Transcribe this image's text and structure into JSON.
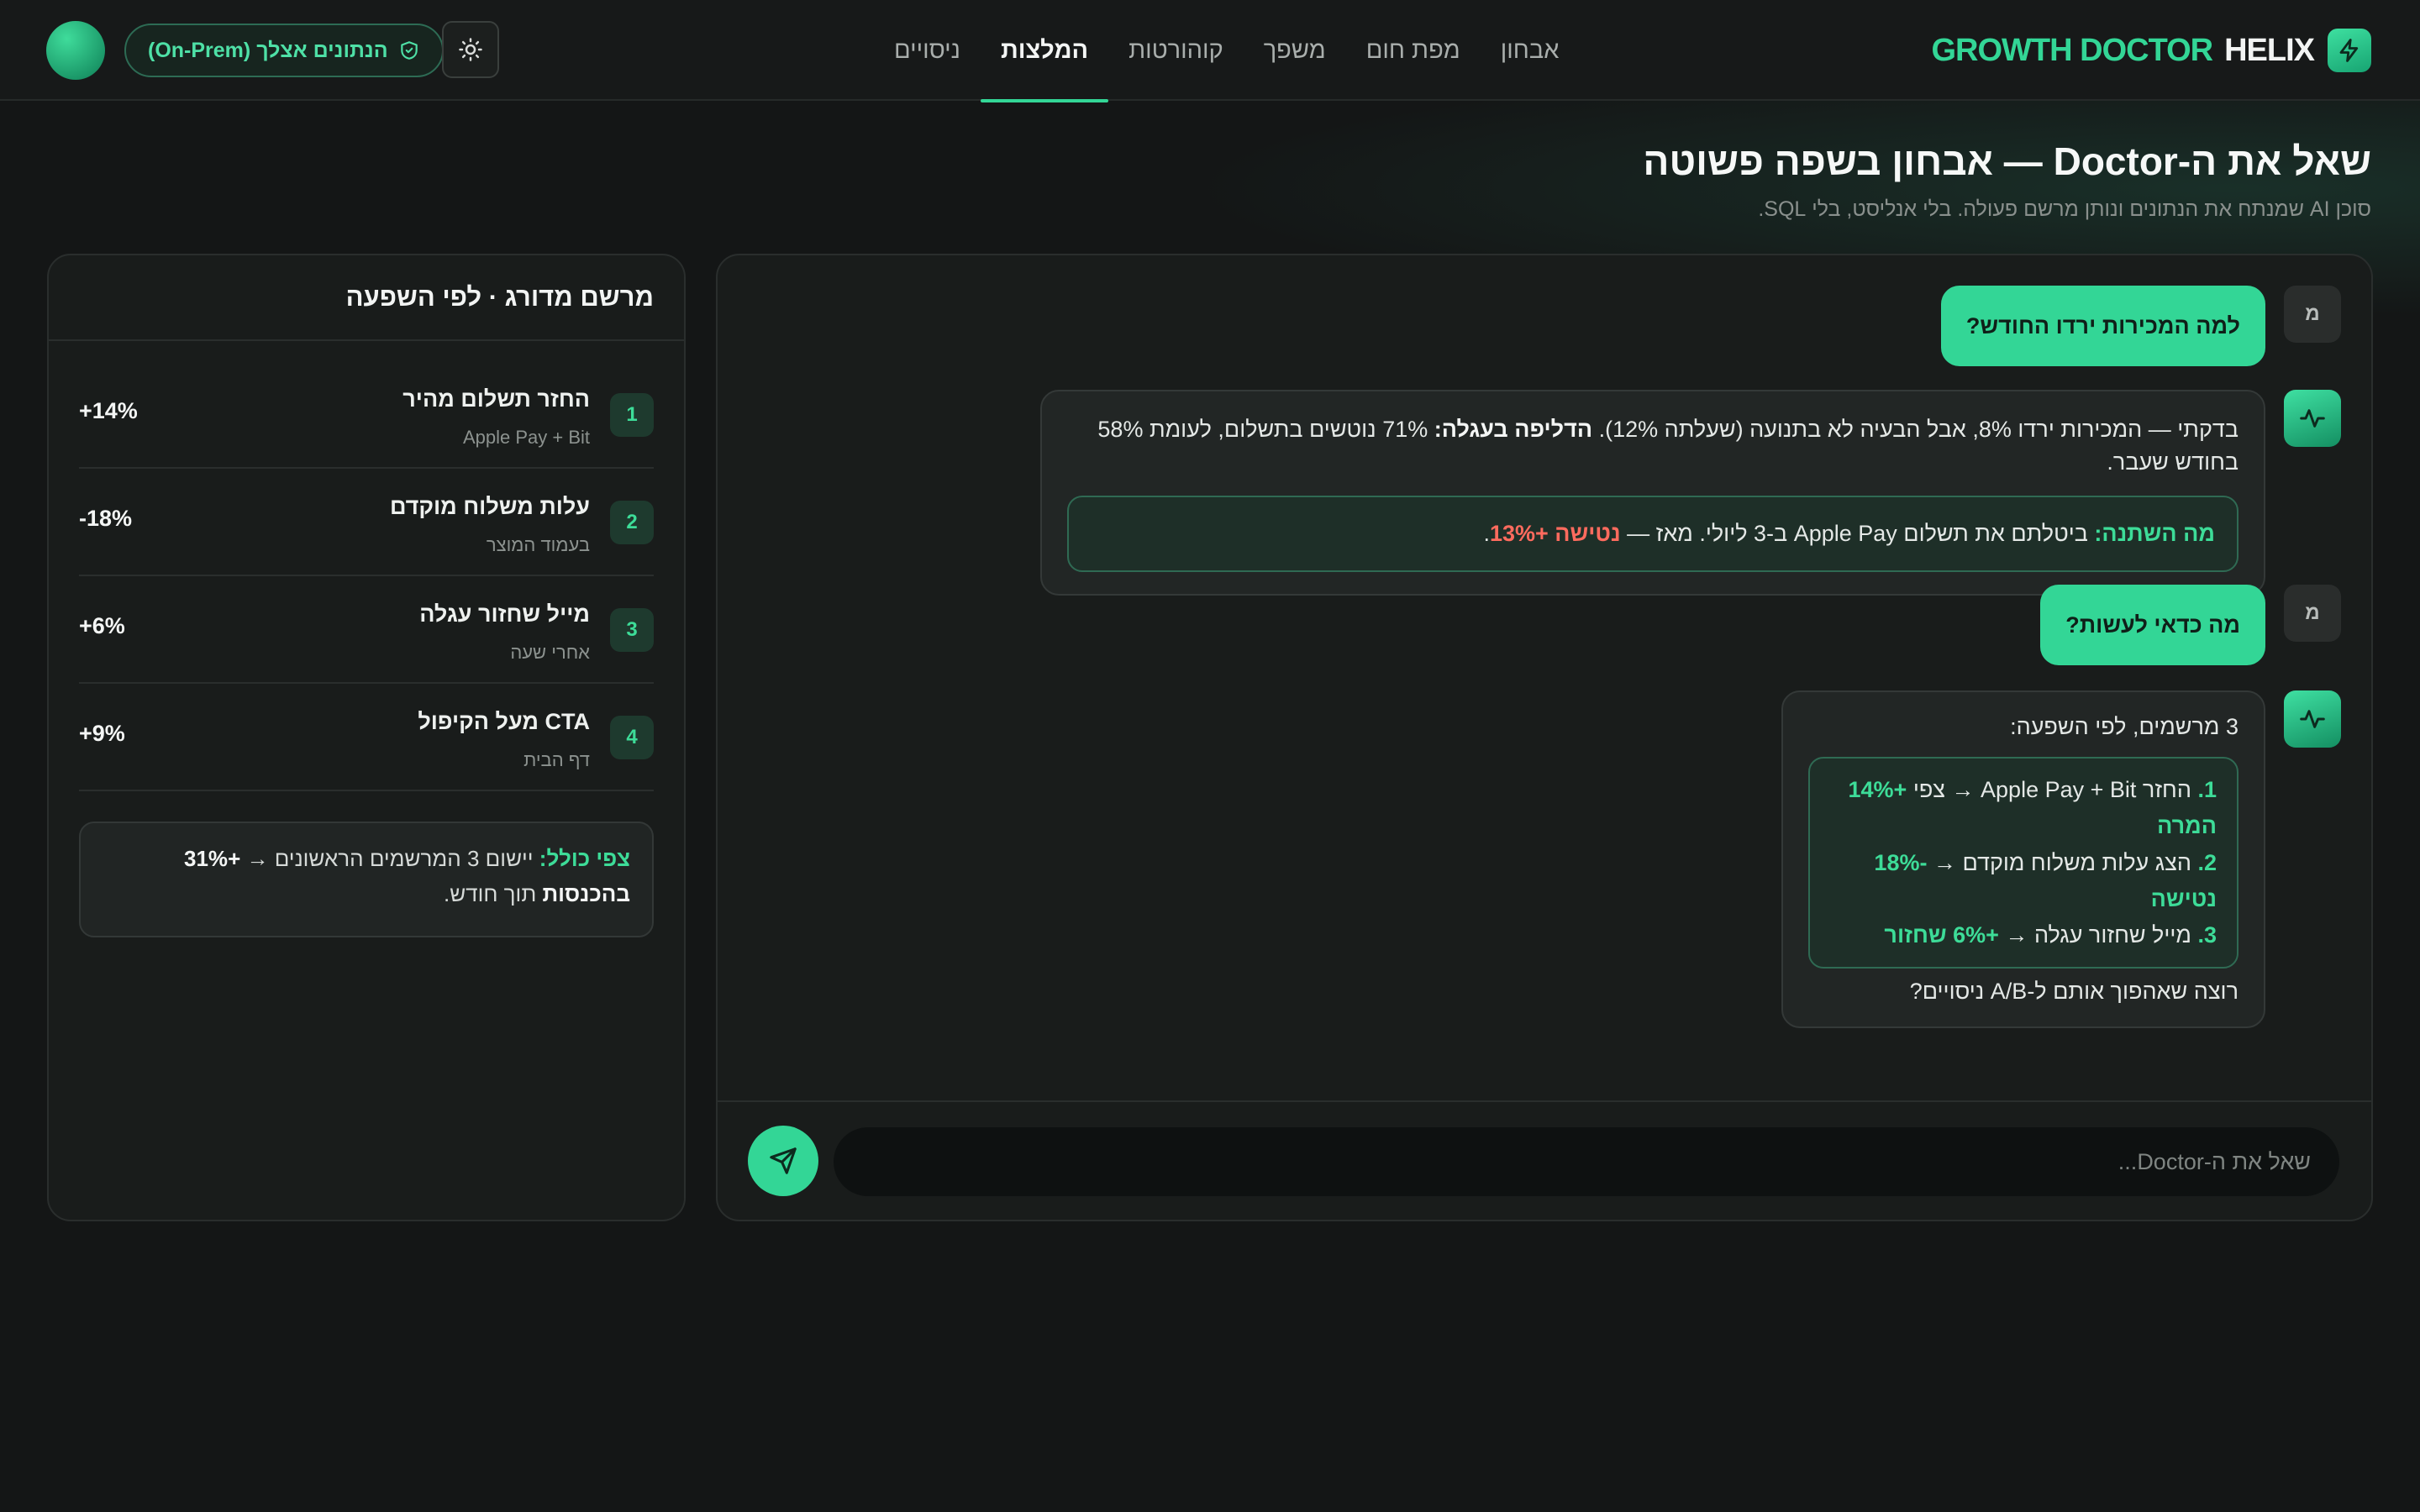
{
  "app": {
    "brand_primary": "GROWTH DOCTOR",
    "brand_secondary": "HELIX",
    "accent_color": "#33d696",
    "badge_label": "הנתונים אצלך (On-Prem)"
  },
  "nav": {
    "items": [
      {
        "label": "אבחון",
        "active": false
      },
      {
        "label": "מפת חום",
        "active": false
      },
      {
        "label": "משפך",
        "active": false
      },
      {
        "label": "קוהורטות",
        "active": false
      },
      {
        "label": "המלצות",
        "active": true
      },
      {
        "label": "ניסויים",
        "active": false
      }
    ]
  },
  "page": {
    "title": "שאל את ה-Doctor — אבחון בשפה פשוטה",
    "subtitle": "סוכן AI שמנתח את הנתונים ונותן מרשם פעולה. בלי אנליסט, בלי SQL."
  },
  "chat": {
    "user_initial": "מ",
    "messages": [
      {
        "role": "user",
        "text": "למה המכירות ירדו החודש?"
      },
      {
        "role": "bot",
        "p1_plain": "בדקתי — המכירות ירדו 8%, אבל הבעיה לא בתנועה (שעלתה 12%). ",
        "p1_bold": "הדליפה בעגלה:",
        "p1_rest": " 71% נוטשים בתשלום, לעומת 58% בחודש שעבר.",
        "callout_label": "מה השתנה:",
        "callout_text": " ביטלתם את תשלום Apple Pay ב-3 ליולי. מאז — ",
        "callout_alert": "נטישה +13%",
        "callout_end": "."
      },
      {
        "role": "user",
        "text": "מה כדאי לעשות?"
      },
      {
        "role": "bot",
        "intro": "3 מרשמים, לפי השפעה:",
        "items": [
          {
            "num": "1.",
            "text": " החזר Apple Pay + Bit → צפי ",
            "impact": "+14% המרה"
          },
          {
            "num": "2.",
            "text": " הצג עלות משלוח מוקדם → ",
            "impact": "-18% נטישה"
          },
          {
            "num": "3.",
            "text": " מייל שחזור עגלה → ",
            "impact": "+6% שחזור"
          }
        ],
        "outro": "רוצה שאהפוך אותם ל-A/B ניסויים?"
      }
    ],
    "input_placeholder": "שאל את ה-Doctor..."
  },
  "prescriptions": {
    "title": "מרשם מדורג · לפי השפעה",
    "items": [
      {
        "rank": "1",
        "title": "החזר תשלום מהיר",
        "subtitle": "Apple Pay + Bit",
        "impact": "+14%"
      },
      {
        "rank": "2",
        "title": "עלות משלוח מוקדם",
        "subtitle": "בעמוד המוצר",
        "impact": "-18%"
      },
      {
        "rank": "3",
        "title": "מייל שחזור עגלה",
        "subtitle": "אחרי שעה",
        "impact": "+6%"
      },
      {
        "rank": "4",
        "title": "CTA מעל הקיפול",
        "subtitle": "דף הבית",
        "impact": "+9%"
      }
    ],
    "summary_label": "צפי כולל:",
    "summary_text": " יישום 3 המרשמים הראשונים → ",
    "summary_bold": "+31% בהכנסות",
    "summary_end": " תוך חודש."
  }
}
